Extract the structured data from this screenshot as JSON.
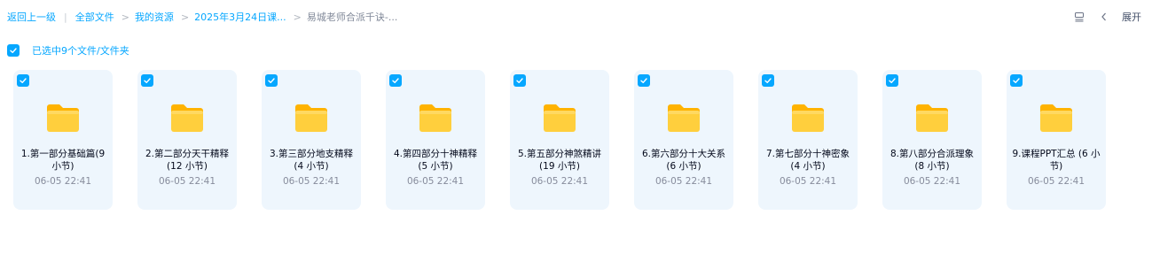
{
  "breadcrumb": {
    "back": "返回上一级",
    "items": [
      "全部文件",
      "我的资源",
      "2025年3月24日课...",
      "易城老师合派千诀-..."
    ]
  },
  "top_right": {
    "expand_label": "展开"
  },
  "selection": {
    "text": "已选中9个文件/文件夹"
  },
  "files": [
    {
      "name": "1.第一部分基础篇(9 小节)",
      "date": "06-05 22:41"
    },
    {
      "name": "2.第二部分天干精释 (12 小节)",
      "date": "06-05 22:41"
    },
    {
      "name": "3.第三部分地支精释 (4 小节)",
      "date": "06-05 22:41"
    },
    {
      "name": "4.第四部分十神精释 (5 小节)",
      "date": "06-05 22:41"
    },
    {
      "name": "5.第五部分神煞精讲 (19 小节)",
      "date": "06-05 22:41"
    },
    {
      "name": "6.第六部分十大关系 (6 小节)",
      "date": "06-05 22:41"
    },
    {
      "name": "7.第七部分十神密象 (4 小节)",
      "date": "06-05 22:41"
    },
    {
      "name": "8.第八部分合派理象 (8 小节)",
      "date": "06-05 22:41"
    },
    {
      "name": "9.课程PPT汇总 (6 小节)",
      "date": "06-05 22:41"
    }
  ],
  "colors": {
    "accent": "#06a7ff",
    "card_bg": "#eef6fd",
    "folder": "#ffc933"
  }
}
